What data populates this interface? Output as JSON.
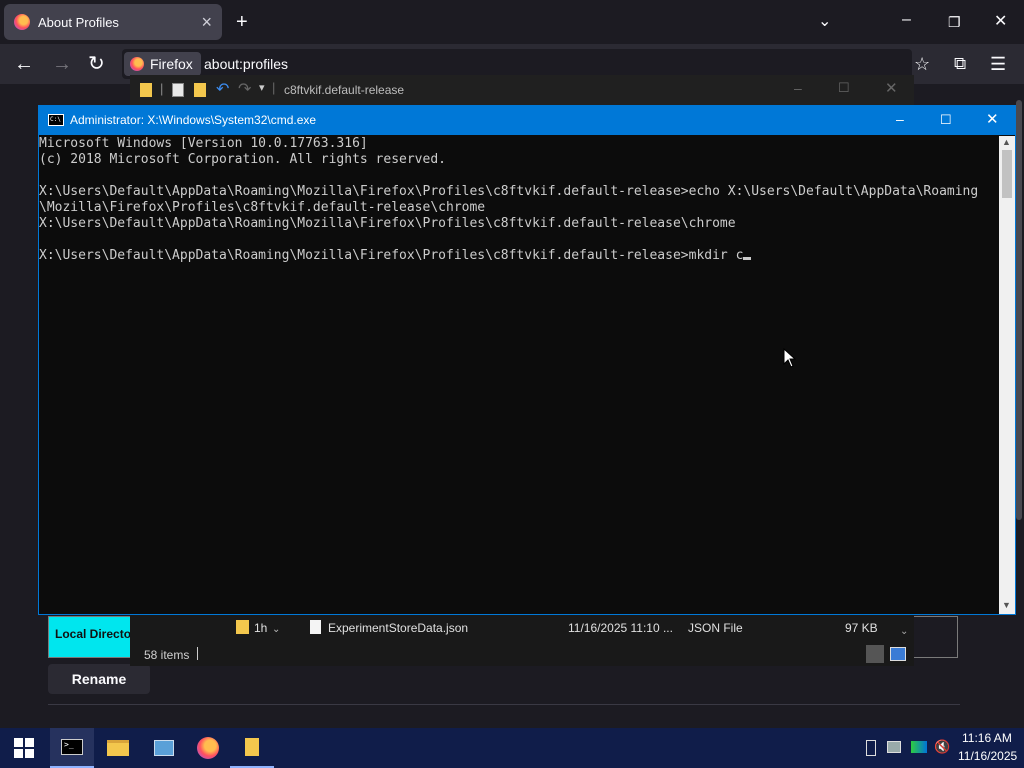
{
  "firefox": {
    "tab_title": "About Profiles",
    "identity_label": "Firefox",
    "url": "about:profiles"
  },
  "explorer": {
    "path": "c8ftvkif.default-release",
    "row": {
      "folder_name": "1h",
      "file_name": "ExperimentStoreData.json",
      "date": "11/16/2025 11:10 ...",
      "type": "JSON File",
      "size": "97 KB"
    },
    "status": "58 items"
  },
  "page": {
    "local_directory_label": "Local Directory",
    "rename_label": "Rename"
  },
  "cmd": {
    "title": "Administrator: X:\\Windows\\System32\\cmd.exe",
    "lines": [
      "Microsoft Windows [Version 10.0.17763.316]",
      "(c) 2018 Microsoft Corporation. All rights reserved.",
      "",
      "X:\\Users\\Default\\AppData\\Roaming\\Mozilla\\Firefox\\Profiles\\c8ftvkif.default-release>echo X:\\Users\\Default\\AppData\\Roaming",
      "\\Mozilla\\Firefox\\Profiles\\c8ftvkif.default-release\\chrome",
      "X:\\Users\\Default\\AppData\\Roaming\\Mozilla\\Firefox\\Profiles\\c8ftvkif.default-release\\chrome",
      "",
      "X:\\Users\\Default\\AppData\\Roaming\\Mozilla\\Firefox\\Profiles\\c8ftvkif.default-release>mkdir c"
    ]
  },
  "taskbar": {
    "time": "11:16 AM",
    "date": "11/16/2025"
  },
  "colors": {
    "cmd_title": "#0078d7",
    "taskbar": "#101d4a",
    "local_dir_cell": "#00e6ee"
  }
}
